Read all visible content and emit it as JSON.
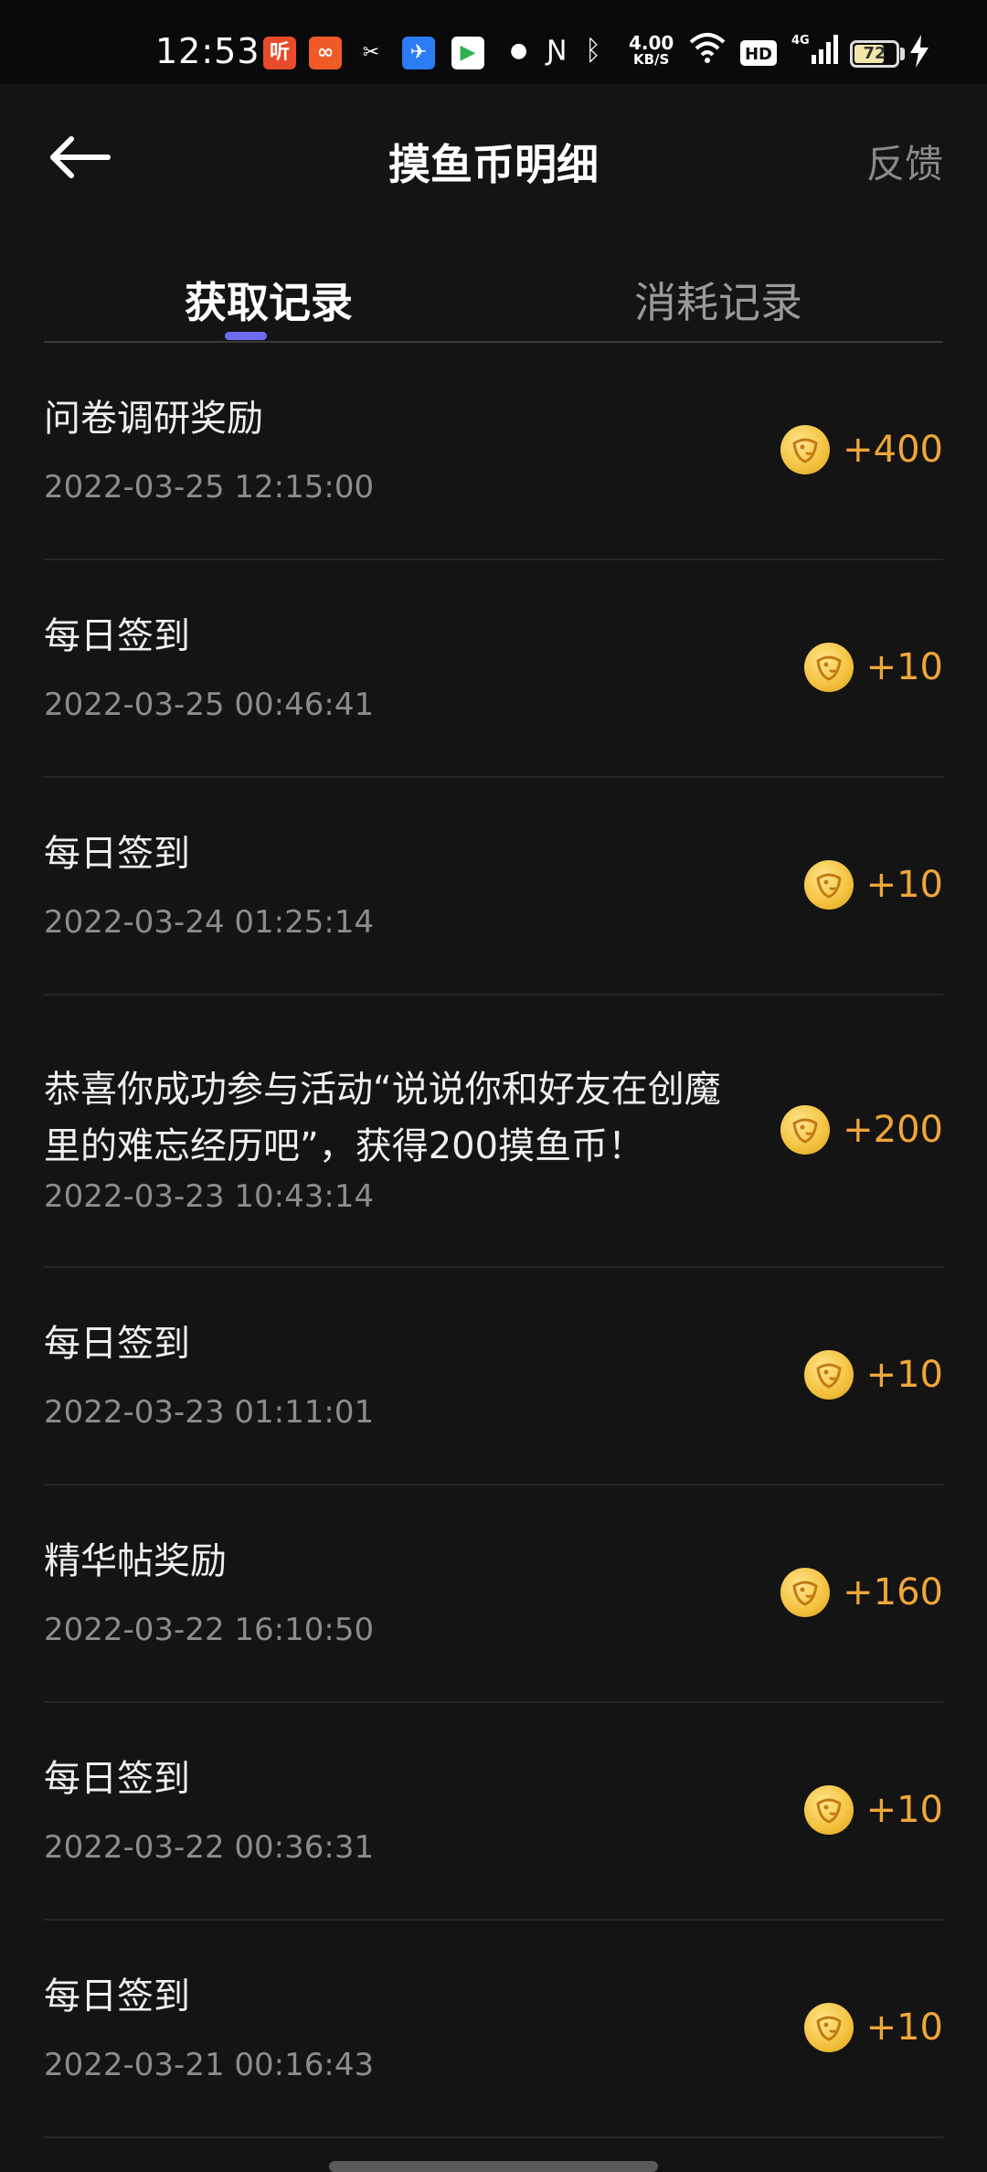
{
  "status_bar": {
    "time": "12:53",
    "net_speed_value": "4.00",
    "net_speed_unit": "KB/S",
    "battery_level": "72",
    "battery_fraction": 0.72,
    "apps": [
      {
        "name": "ting-app-icon",
        "glyph": "听",
        "color": "#e84b2a"
      },
      {
        "name": "kuaishou-app-icon",
        "glyph": "∞",
        "color": "#f05a28"
      },
      {
        "name": "capcut-app-icon",
        "glyph": "✂",
        "color": "#0a0a0a"
      },
      {
        "name": "navigation-app-icon",
        "glyph": "✈",
        "color": "#2b7cf5"
      },
      {
        "name": "video-app-icon",
        "glyph": "▶",
        "color": "#ffffff"
      }
    ]
  },
  "header": {
    "title": "摸鱼币明细",
    "feedback_label": "反馈"
  },
  "tabs": [
    {
      "label": "获取记录",
      "active": true
    },
    {
      "label": "消耗记录",
      "active": false
    }
  ],
  "records": [
    {
      "title": "问卷调研奖励",
      "date": "2022-03-25 12:15:00",
      "amount": "+400"
    },
    {
      "title": "每日签到",
      "date": "2022-03-25 00:46:41",
      "amount": "+10"
    },
    {
      "title": "每日签到",
      "date": "2022-03-24 01:25:14",
      "amount": "+10"
    },
    {
      "title": "恭喜你成功参与活动“说说你和好友在创魔里的难忘经历吧”，获得200摸鱼币！",
      "date": "2022-03-23 10:43:14",
      "amount": "+200"
    },
    {
      "title": "每日签到",
      "date": "2022-03-23 01:11:01",
      "amount": "+10"
    },
    {
      "title": "精华帖奖励",
      "date": "2022-03-22 16:10:50",
      "amount": "+160"
    },
    {
      "title": "每日签到",
      "date": "2022-03-22 00:36:31",
      "amount": "+10"
    },
    {
      "title": "每日签到",
      "date": "2022-03-21 00:16:43",
      "amount": "+10"
    }
  ],
  "colors": {
    "background": "#141414",
    "accent_tab": "#6e6cf0",
    "amount": "#f0a639",
    "coin": "#f3c13e"
  }
}
